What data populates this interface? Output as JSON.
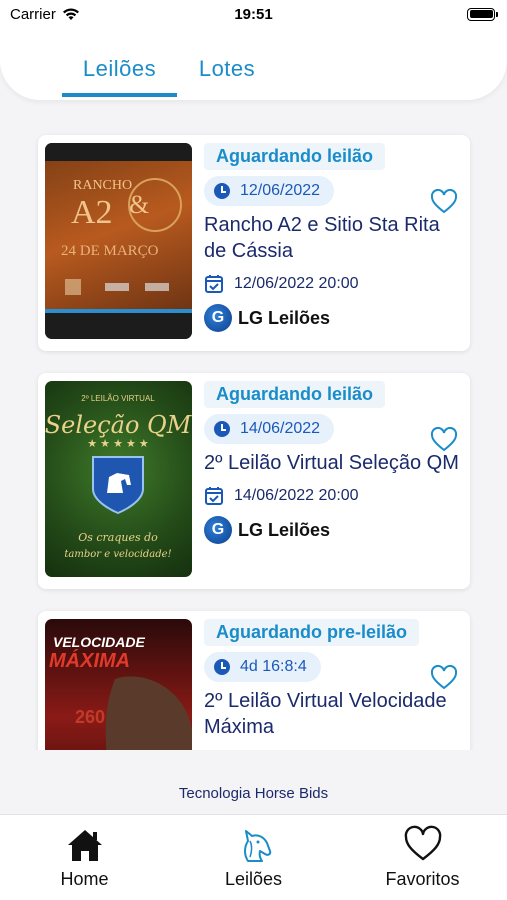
{
  "status_bar": {
    "carrier": "Carrier",
    "time": "19:51"
  },
  "tabs": [
    {
      "label": "Leilões",
      "active": true
    },
    {
      "label": "Lotes",
      "active": false
    }
  ],
  "accent_color": "#1a8cc9",
  "auctions": [
    {
      "status": "Aguardando leilão",
      "date_chip": "12/06/2022",
      "title": "Rancho A2 e Sitio Sta Rita de Cássia",
      "datetime": "12/06/2022 20:00",
      "organizer": "LG Leilões",
      "thumb": {
        "line1": "RANCHO",
        "line2": "A2",
        "line3": "24 DE MARÇO"
      }
    },
    {
      "status": "Aguardando leilão",
      "date_chip": "14/06/2022",
      "title": "2º Leilão Virtual Seleção QM",
      "datetime": "14/06/2022 20:00",
      "organizer": "LG Leilões",
      "thumb": {
        "line1": "2º LEILÃO VIRTUAL",
        "line2": "Seleção QM",
        "line3": "Os craques do tambor e velocidade!"
      }
    },
    {
      "status": "Aguardando pre-leilão",
      "date_chip": "4d 16:8:4",
      "title": "2º Leilão Virtual Velocidade Máxima",
      "datetime": "",
      "organizer": "",
      "thumb": {
        "line1": "VELOCIDADE",
        "line2": "MÁXIMA",
        "line3": "260"
      }
    }
  ],
  "footer_credit": "Tecnologia Horse Bids",
  "bottom_nav": [
    {
      "label": "Home",
      "icon": "home-icon"
    },
    {
      "label": "Leilões",
      "icon": "horse-head-icon"
    },
    {
      "label": "Favoritos",
      "icon": "heart-icon"
    }
  ]
}
